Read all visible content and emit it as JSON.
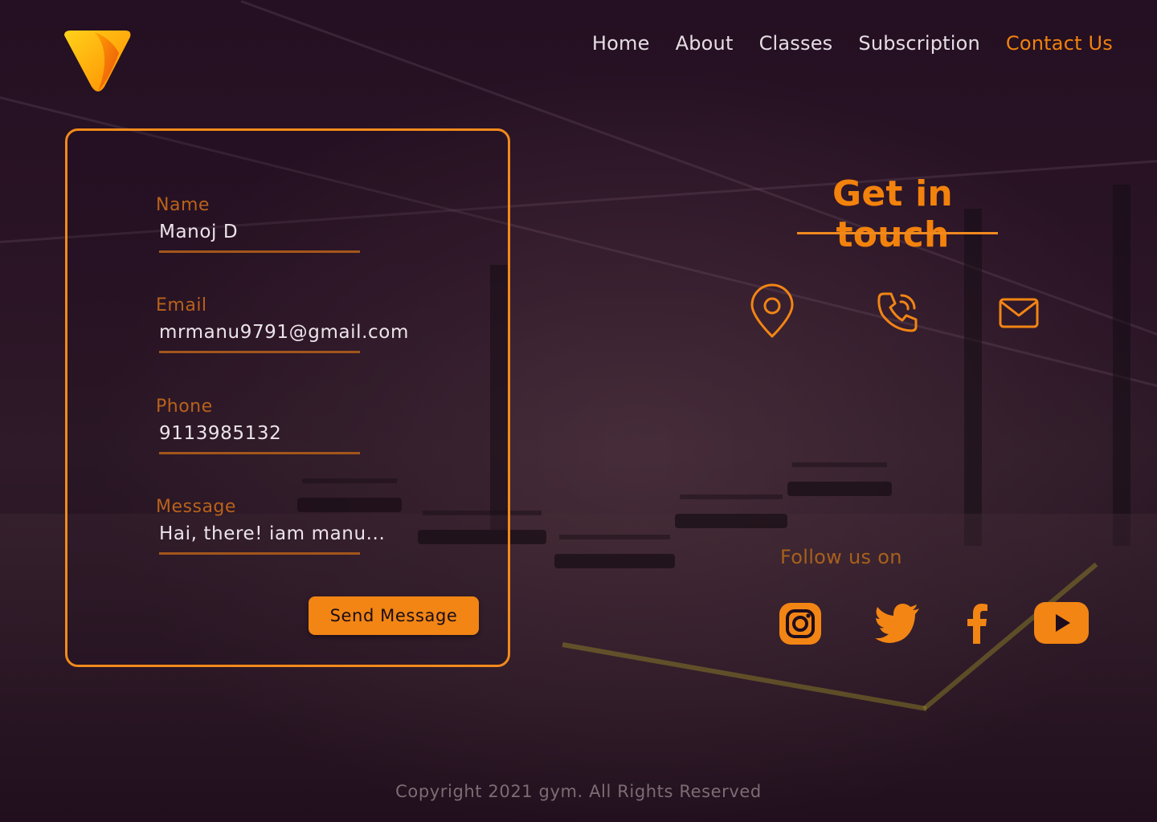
{
  "nav": {
    "items": [
      {
        "label": "Home",
        "active": false
      },
      {
        "label": "About",
        "active": false
      },
      {
        "label": "Classes",
        "active": false
      },
      {
        "label": "Subscription",
        "active": false
      },
      {
        "label": "Contact Us",
        "active": true
      }
    ]
  },
  "form": {
    "fields": [
      {
        "label": "Name",
        "value": "Manoj D"
      },
      {
        "label": "Email",
        "value": "mrmanu9791@gmail.com"
      },
      {
        "label": "Phone",
        "value": "9113985132"
      },
      {
        "label": "Message",
        "value": "Hai, there! iam manu..."
      }
    ],
    "send_label": "Send Message"
  },
  "contact": {
    "title": "Get in touch",
    "icons": [
      "location-pin-icon",
      "phone-icon",
      "mail-icon"
    ]
  },
  "social": {
    "heading": "Follow us on",
    "icons": [
      "instagram-icon",
      "twitter-icon",
      "facebook-icon",
      "youtube-icon"
    ]
  },
  "footer": {
    "copyright": "Copyright 2021 gym. All Rights Reserved"
  },
  "colors": {
    "accent": "#f28514",
    "background": "#1e0d1d",
    "label": "#b9621a",
    "text": "#ece4ea"
  }
}
